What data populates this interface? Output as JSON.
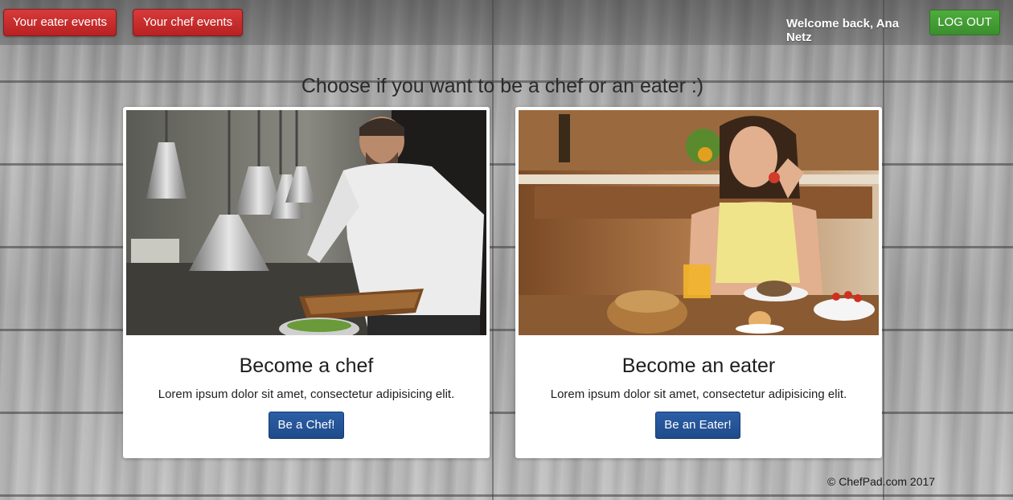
{
  "nav": {
    "eater_events_label": "Your eater events",
    "chef_events_label": "Your chef events",
    "welcome_text": "Welcome back, Ana Netz",
    "logout_label": "LOG OUT"
  },
  "main": {
    "headline": "Choose if you want to be a chef or an eater :)",
    "cards": [
      {
        "title": "Become a chef",
        "text": "Lorem ipsum dolor sit amet, consectetur adipisicing elit.",
        "button_label": "Be a Chef!"
      },
      {
        "title": "Become an eater",
        "text": "Lorem ipsum dolor sit amet, consectetur adipisicing elit.",
        "button_label": "Be an Eater!"
      }
    ]
  },
  "footer": {
    "copyright": "© ChefPad.com 2017"
  },
  "colors": {
    "nav_button_red": "#c62d2d",
    "logout_green": "#44a034",
    "action_blue": "#24528f",
    "card_bg": "#ffffff",
    "wood_gray": "#a6a6a6"
  }
}
